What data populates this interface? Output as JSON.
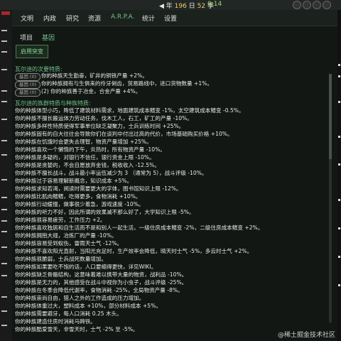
{
  "topbar": {
    "date_prefix": "◀ 年",
    "year": "196",
    "date_mid": "日",
    "day": "52",
    "date_suffix": "季",
    "time": "0:14"
  },
  "menu": [
    "文明",
    "内政",
    "研究",
    "资源",
    "A.R.P.A.",
    "统计",
    "设置"
  ],
  "subtabs": [
    "项目",
    "基因"
  ],
  "enable_button": "启用突变",
  "minor_heading": "瓦尔迪的次要特质:",
  "minor_pill_label": "基因 (0)",
  "minor_traits": [
    "你的种族天生勤奋，矿井的铜铁产量 +2%。",
    "你的种族拥有与生俱来的伶牙俐齿，贸易路线中，进口货物数量 +1%。",
    "(2) 你的种族善于冶金，合金产量 +4%。"
  ],
  "major_heading": "瓦尔迪的族群特质与种族特质:",
  "major_traits": [
    "你的种族体型小巧，降低了建筑材料需求，地面建筑成本鳍变 -1%，太空建筑成本鳍变 -0.5%。",
    "你的种族不擅长搬运体力劳动任务，伐木工人，石工，矿工的产量 -10%。",
    "你的种族多样性特质使得军事单位缺乏凝聚力，士兵训练时间 +25%。",
    "你的种族固有的自大往往会导致你们在谈判中付出过高的代价，市场基础购买价格 +10%。",
    "你的种族在饥饿时会更失去理智，物资产量增加 +25%。",
    "你的种族喜欢一个懒惰的下午，炎热时，所有物资产量 -10%。",
    "你的种族是多疑的，对银行不信任，银行资金上限 -10%。",
    "你的种族是贪婪的，不会自愿放弃金钱，税收收入 -12.5%。",
    "你的种族不擅长战斗，战斗最小率运伍减少为 3 （通常为 5），战斗评级 -10%。",
    "你的种族过于容易理解新概念，知识成本 +5%。",
    "你的种族求知若渴，阅读时需要更大的字体，图书馆知识上限 -12%。",
    "你的种族比肌肉鳍鳍，吃得更多，食物消耗 +10%。",
    "你的种族行动缓慢，做事很少着急，游戏速度 -10%。",
    "你的种族的听力不好，因此所谓的效果减不那么好了，大学知识上限 -5%。",
    "你的种族很容易疲劳，工作压力 +2。",
    "你的种族喜欢独居和自生活而不是和别人一起生活，一级住房成本鳍变 -2%，二级住房成本鳍变 +2%。",
    "你的种族拥抱大规，冶炼厂的产量 -10%。",
    "你的种族容易受到蚁伤，雷雨天士气 -12%。",
    "你的种族不喜欢阳光直射，当阳光充足时，生产效率会降低，晴天时士气 -5%，多云时士气 +2%。",
    "你的种族很脆弱，士兵战死数量增加。",
    "你的种族如果要吃不饱的话，人口要缩得更快，详见WIKI。",
    "你的种族缺乏骨骼结构，这意味着难以携带大量的物资，战利品 -10%。",
    "你的种族是无力的，其他感受在战斗中视你为小虫子，战斗评级 -25%。",
    "你的种族在冬季会降低代谢率，食物消耗 -25%，全局物资产量 -8%。",
    "你的种族崇尚自由，猎人之外的工作造成的压力增加。",
    "你的种族体重过大，塑料成本 +10%，部分材料成本 +5%。",
    "你的种族需要避牙，每人口消耗 0.25 木头。",
    "你的种族建造住房时消耗马蹄铁。",
    "你的种族酷爱雪天，非雪天时，士气 -2% 至 -5%。"
  ],
  "watermark": "@稀土掘金技术社区"
}
